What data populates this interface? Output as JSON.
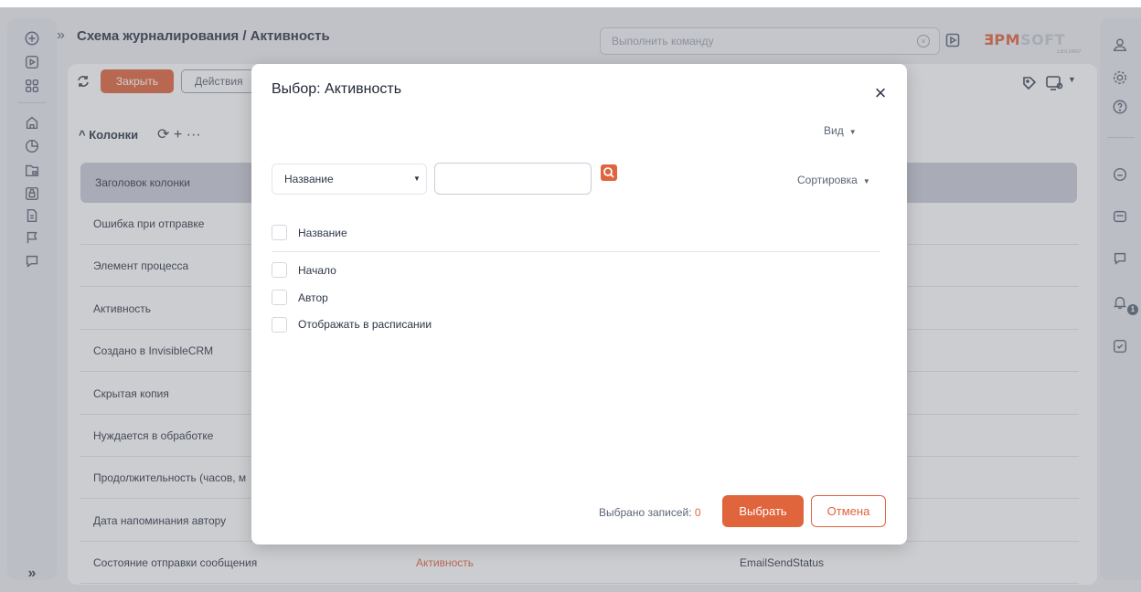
{
  "colors": {
    "accent": "#e0643c",
    "header_bg": "#c9cdd8",
    "overlay": "rgba(110,112,120,0.35)"
  },
  "header": {
    "title": "Схема журналирования / Активность",
    "command_placeholder": "Выполнить команду",
    "logo_part1": "ƎPM",
    "logo_part2": "SOFT",
    "version": "1.8.0.14507"
  },
  "toolbar": {
    "close_label": "Закрыть",
    "actions_label": "Действия"
  },
  "section": {
    "title": "Колонки",
    "tools": "⟳ + ···"
  },
  "table": {
    "header": "Заголовок колонки",
    "rows": [
      {
        "name": "Ошибка при отправке",
        "object": "",
        "code": ""
      },
      {
        "name": "Элемент процесса",
        "object": "",
        "code": ""
      },
      {
        "name": "Активность",
        "object": "",
        "code": ""
      },
      {
        "name": "Создано в InvisibleCRM",
        "object": "",
        "code": ""
      },
      {
        "name": "Скрытая копия",
        "object": "",
        "code": ""
      },
      {
        "name": "Нуждается в обработке",
        "object": "",
        "code": ""
      },
      {
        "name": "Продолжительность (часов, м",
        "object": "",
        "code": ""
      },
      {
        "name": "Дата напоминания автору",
        "object": "",
        "code": ""
      },
      {
        "name": "Состояние отправки сообщения",
        "object": "Активность",
        "code": "EmailSendStatus"
      }
    ]
  },
  "rail": {
    "expand_label": "»",
    "notification_count": "1"
  },
  "dialog": {
    "title": "Выбор: Активность",
    "close_symbol": "×",
    "view_label": "Вид",
    "filter_column": "Название",
    "search_value": "",
    "sort_label": "Сортировка",
    "list_header": "Название",
    "items": [
      "Начало",
      "Автор",
      "Отображать в расписании"
    ],
    "selected_label": "Выбрано записей:",
    "selected_count": "0",
    "select_button": "Выбрать",
    "cancel_button": "Отмена"
  },
  "icons": {
    "left_rail": [
      "plus-circle-icon",
      "play-icon",
      "apps-grid-icon",
      "home-icon",
      "pie-chart-icon",
      "lock-folder-icon",
      "lock-box-icon",
      "document-icon",
      "flag-icon",
      "chat-icon"
    ],
    "right_rail": [
      "user-icon",
      "settings-icon",
      "help-icon",
      "inbox-icon",
      "email-icon",
      "message-icon",
      "bell-icon",
      "task-check-icon"
    ]
  }
}
